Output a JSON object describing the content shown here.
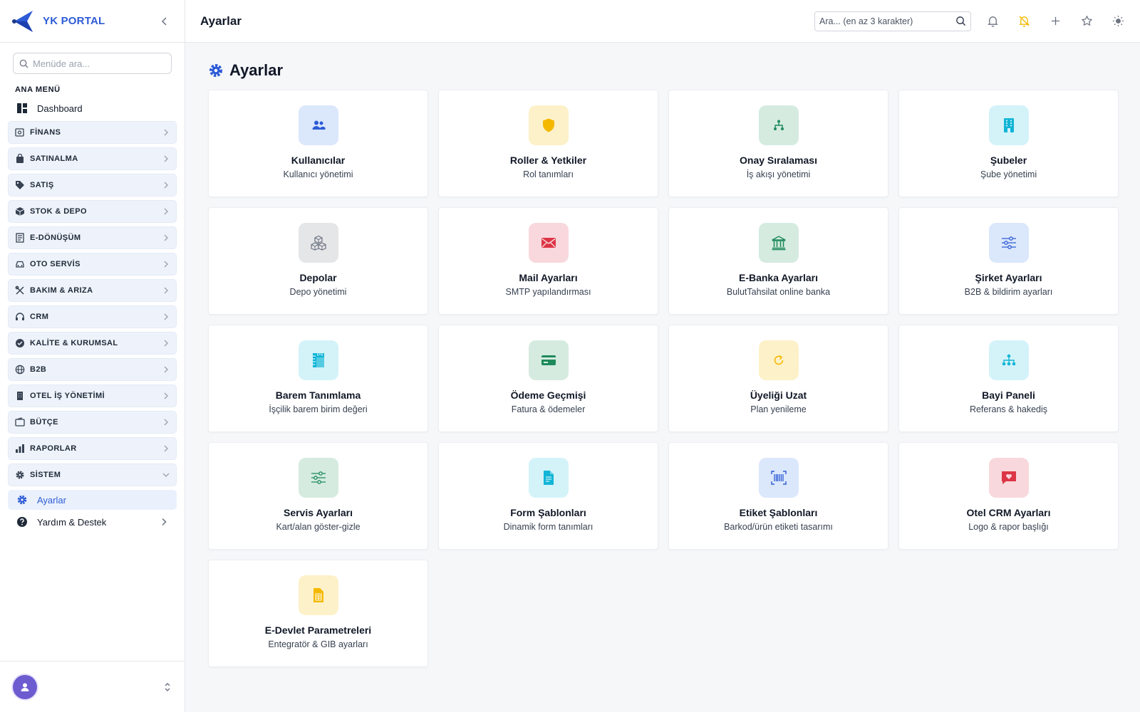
{
  "brand": {
    "name": "YK PORTAL"
  },
  "sidebar": {
    "search_placeholder": "Menüde ara...",
    "section_title": "ANA MENÜ",
    "dashboard_label": "Dashboard",
    "groups": [
      {
        "label": "FİNANS",
        "icon": "finance-icon"
      },
      {
        "label": "SATINALMA",
        "icon": "shopping-bag-icon"
      },
      {
        "label": "SATIŞ",
        "icon": "tag-icon"
      },
      {
        "label": "STOK & DEPO",
        "icon": "box-icon"
      },
      {
        "label": "E-DÖNÜŞÜM",
        "icon": "document-list-icon"
      },
      {
        "label": "OTO SERVİS",
        "icon": "car-icon"
      },
      {
        "label": "BAKIM & ARIZA",
        "icon": "tools-icon"
      },
      {
        "label": "CRM",
        "icon": "headset-icon"
      },
      {
        "label": "KALİTE & KURUMSAL",
        "icon": "badge-check-icon"
      },
      {
        "label": "B2B",
        "icon": "globe-icon"
      },
      {
        "label": "OTEL İŞ YÖNETİMİ",
        "icon": "building-icon"
      },
      {
        "label": "BÜTÇE",
        "icon": "wallet-icon"
      },
      {
        "label": "RAPORLAR",
        "icon": "bar-chart-icon"
      },
      {
        "label": "SİSTEM",
        "icon": "gear-icon",
        "expanded": true
      }
    ],
    "active_item_label": "Ayarlar",
    "help_label": "Yardım & Destek"
  },
  "header": {
    "title": "Ayarlar",
    "search_placeholder": "Ara... (en az 3 karakter)",
    "icons": [
      "bell-icon",
      "bell-off-icon",
      "plus-icon",
      "star-icon",
      "sun-icon"
    ]
  },
  "main": {
    "page_title": "Ayarlar",
    "cards": [
      {
        "title": "Kullanıcılar",
        "subtitle": "Kullanıcı yönetimi",
        "icon": "users-icon",
        "tile_bg": "#dbe7fb",
        "icon_color": "#2d5bd6"
      },
      {
        "title": "Roller & Yetkiler",
        "subtitle": "Rol tanımları",
        "icon": "shield-icon",
        "tile_bg": "#fdf1c9",
        "icon_color": "#f5b800"
      },
      {
        "title": "Onay Sıralaması",
        "subtitle": "İş akışı yönetimi",
        "icon": "hierarchy-icon",
        "tile_bg": "#d5ebe0",
        "icon_color": "#1f8a5b"
      },
      {
        "title": "Şubeler",
        "subtitle": "Şube yönetimi",
        "icon": "building-icon",
        "tile_bg": "#d3f3f9",
        "icon_color": "#12b5d6"
      },
      {
        "title": "Depolar",
        "subtitle": "Depo yönetimi",
        "icon": "boxes-icon",
        "tile_bg": "#e5e6e8",
        "icon_color": "#6b7280"
      },
      {
        "title": "Mail Ayarları",
        "subtitle": "SMTP yapılandırması",
        "icon": "envelope-icon",
        "tile_bg": "#f8d8dc",
        "icon_color": "#dc3545"
      },
      {
        "title": "E-Banka Ayarları",
        "subtitle": "BulutTahsilat online banka",
        "icon": "bank-icon",
        "tile_bg": "#d5ebe0",
        "icon_color": "#1f8a5b"
      },
      {
        "title": "Şirket Ayarları",
        "subtitle": "B2B & bildirim ayarları",
        "icon": "sliders-icon",
        "tile_bg": "#dbe7fb",
        "icon_color": "#2d5bd6"
      },
      {
        "title": "Barem Tanımlama",
        "subtitle": "İşçilik barem birim değeri",
        "icon": "ruler-icon",
        "tile_bg": "#d3f3f9",
        "icon_color": "#12b5d6"
      },
      {
        "title": "Ödeme Geçmişi",
        "subtitle": "Fatura & ödemeler",
        "icon": "credit-card-icon",
        "tile_bg": "#d5ebe0",
        "icon_color": "#1f8a5b"
      },
      {
        "title": "Üyeliği Uzat",
        "subtitle": "Plan yenileme",
        "icon": "refresh-icon",
        "tile_bg": "#fdf1c9",
        "icon_color": "#f5b800"
      },
      {
        "title": "Bayi Paneli",
        "subtitle": "Referans & hakediş",
        "icon": "network-icon",
        "tile_bg": "#d3f3f9",
        "icon_color": "#12b5d6"
      },
      {
        "title": "Servis Ayarları",
        "subtitle": "Kart/alan göster-gizle",
        "icon": "sliders-icon",
        "tile_bg": "#d5ebe0",
        "icon_color": "#1f8a5b"
      },
      {
        "title": "Form Şablonları",
        "subtitle": "Dinamik form tanımları",
        "icon": "file-text-icon",
        "tile_bg": "#d3f3f9",
        "icon_color": "#12b5d6"
      },
      {
        "title": "Etiket Şablonları",
        "subtitle": "Barkod/ürün etiketi tasarımı",
        "icon": "barcode-icon",
        "tile_bg": "#dbe7fb",
        "icon_color": "#2d5bd6"
      },
      {
        "title": "Otel CRM Ayarları",
        "subtitle": "Logo & rapor başlığı",
        "icon": "heart-message-icon",
        "tile_bg": "#f8d8dc",
        "icon_color": "#dc3545"
      },
      {
        "title": "E-Devlet Parametreleri",
        "subtitle": "Entegratör & GIB ayarları",
        "icon": "spreadsheet-icon",
        "tile_bg": "#fdf1c9",
        "icon_color": "#f5b800"
      }
    ]
  }
}
